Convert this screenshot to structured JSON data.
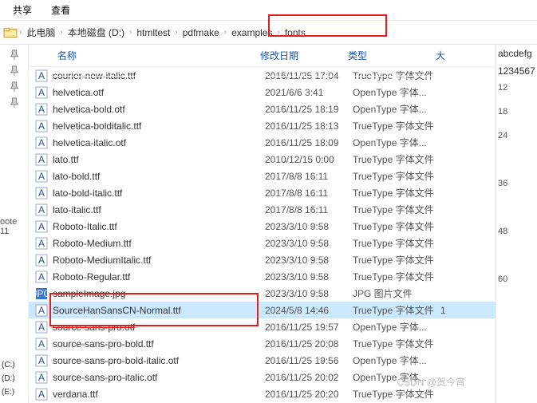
{
  "menu": {
    "share": "共享",
    "view": "查看"
  },
  "breadcrumb": [
    {
      "label": "此电脑"
    },
    {
      "label": "本地磁盘 (D:)"
    },
    {
      "label": "htmltest"
    },
    {
      "label": "pdfmake"
    },
    {
      "label": "examples"
    },
    {
      "label": "fonts"
    }
  ],
  "columns": {
    "name": "名称",
    "date": "修改日期",
    "type": "类型",
    "size": "大"
  },
  "files": [
    {
      "icon": "font",
      "name": "courier-new-italic.ttf",
      "date": "2016/11/25 17:04",
      "type": "TrueType 字体文件",
      "size": ""
    },
    {
      "icon": "font",
      "name": "helvetica.otf",
      "date": "2021/6/6 3:41",
      "type": "OpenType 字体...",
      "size": ""
    },
    {
      "icon": "font",
      "name": "helvetica-bold.otf",
      "date": "2016/11/25 18:19",
      "type": "OpenType 字体...",
      "size": ""
    },
    {
      "icon": "font",
      "name": "helvetica-bolditalic.ttf",
      "date": "2016/11/25 18:13",
      "type": "TrueType 字体文件",
      "size": ""
    },
    {
      "icon": "font",
      "name": "helvetica-italic.otf",
      "date": "2016/11/25 18:09",
      "type": "OpenType 字体...",
      "size": ""
    },
    {
      "icon": "font",
      "name": "lato.ttf",
      "date": "2010/12/15 0:00",
      "type": "TrueType 字体文件",
      "size": ""
    },
    {
      "icon": "font",
      "name": "lato-bold.ttf",
      "date": "2017/8/8 16:11",
      "type": "TrueType 字体文件",
      "size": ""
    },
    {
      "icon": "font",
      "name": "lato-bold-italic.ttf",
      "date": "2017/8/8 16:11",
      "type": "TrueType 字体文件",
      "size": ""
    },
    {
      "icon": "font",
      "name": "lato-italic.ttf",
      "date": "2017/8/8 16:11",
      "type": "TrueType 字体文件",
      "size": ""
    },
    {
      "icon": "font",
      "name": "Roboto-Italic.ttf",
      "date": "2023/3/10 9:58",
      "type": "TrueType 字体文件",
      "size": ""
    },
    {
      "icon": "font",
      "name": "Roboto-Medium.ttf",
      "date": "2023/3/10 9:58",
      "type": "TrueType 字体文件",
      "size": ""
    },
    {
      "icon": "font",
      "name": "Roboto-MediumItalic.ttf",
      "date": "2023/3/10 9:58",
      "type": "TrueType 字体文件",
      "size": ""
    },
    {
      "icon": "font",
      "name": "Roboto-Regular.ttf",
      "date": "2023/3/10 9:58",
      "type": "TrueType 字体文件",
      "size": ""
    },
    {
      "icon": "jpg",
      "name": "sampleImage.jpg",
      "date": "2023/3/10 9:58",
      "type": "JPG 图片文件",
      "size": ""
    },
    {
      "icon": "font",
      "name": "SourceHanSansCN-Normal.ttf",
      "date": "2024/5/8 14:46",
      "type": "TrueType 字体文件",
      "size": "1",
      "selected": true
    },
    {
      "icon": "font",
      "name": "source-sans-pro.otf",
      "date": "2016/11/25 19:57",
      "type": "OpenType 字体...",
      "size": "",
      "strike": true
    },
    {
      "icon": "font",
      "name": "source-sans-pro-bold.ttf",
      "date": "2016/11/25 20:08",
      "type": "TrueType 字体文件",
      "size": ""
    },
    {
      "icon": "font",
      "name": "source-sans-pro-bold-italic.otf",
      "date": "2016/11/25 19:56",
      "type": "OpenType 字体...",
      "size": ""
    },
    {
      "icon": "font",
      "name": "source-sans-pro-italic.otf",
      "date": "2016/11/25 20:02",
      "type": "OpenType 字体...",
      "size": ""
    },
    {
      "icon": "font",
      "name": "verdana.ttf",
      "date": "2016/11/25 20:20",
      "type": "TrueType 字体文件",
      "size": ""
    }
  ],
  "leftnote": "oote 11",
  "drives": [
    "(C:)",
    "(D:)",
    "(E:)"
  ],
  "rightpanel": {
    "head1": "abcdefg",
    "head2": "1234567",
    "rows": [
      "12",
      "18",
      "24",
      "",
      "36",
      "",
      "48",
      "",
      "60"
    ]
  },
  "watermark": "CSDN @贺今宵"
}
